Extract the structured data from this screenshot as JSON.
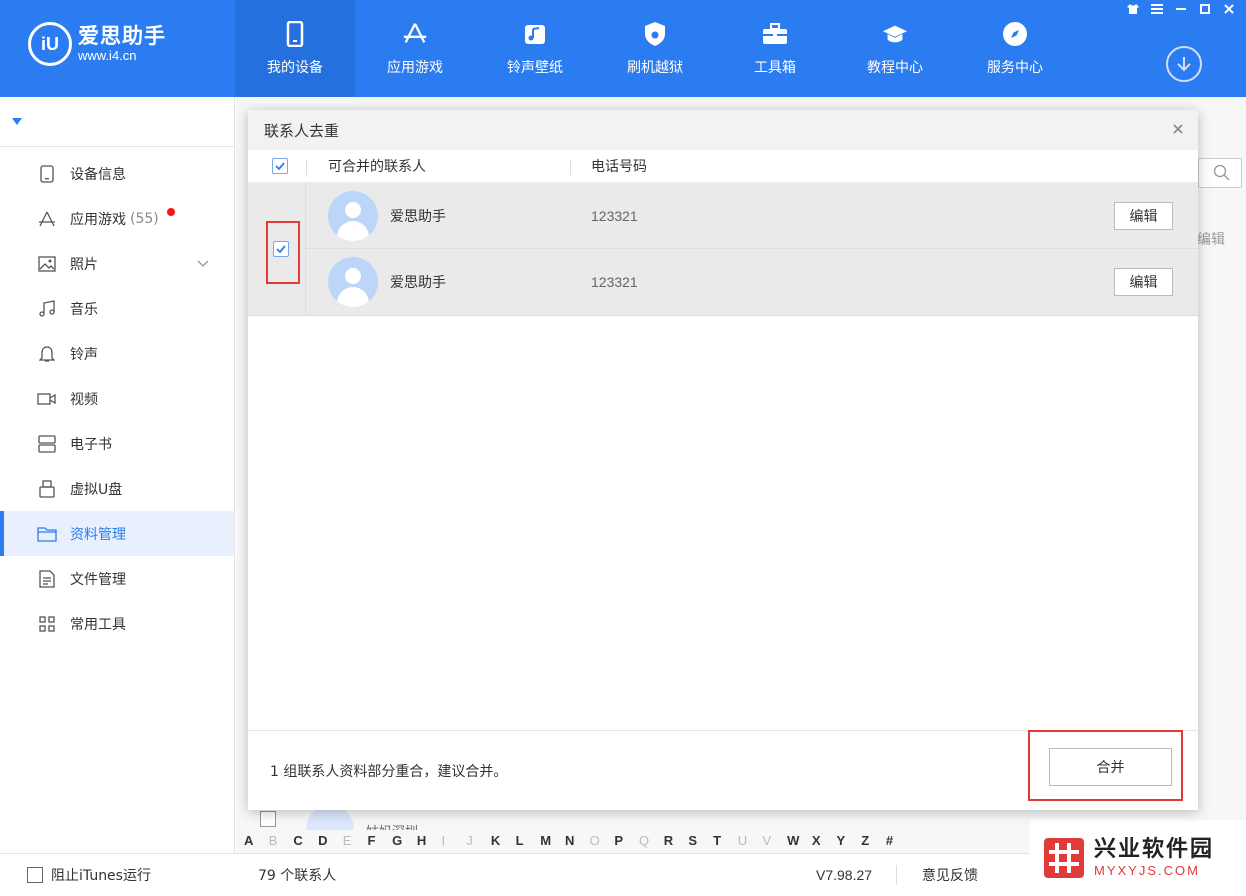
{
  "app": {
    "logo_mark": "iU",
    "logo_title": "爱思助手",
    "logo_url": "www.i4.cn"
  },
  "nav": [
    {
      "label": "我的设备",
      "icon": "phone-icon",
      "active": true
    },
    {
      "label": "应用游戏",
      "icon": "app-store-icon"
    },
    {
      "label": "铃声壁纸",
      "icon": "music-note-icon"
    },
    {
      "label": "刷机越狱",
      "icon": "shield-icon"
    },
    {
      "label": "工具箱",
      "icon": "toolbox-icon"
    },
    {
      "label": "教程中心",
      "icon": "graduation-cap-icon"
    },
    {
      "label": "服务中心",
      "icon": "compass-icon"
    }
  ],
  "sidebar": {
    "items": [
      {
        "label": "设备信息",
        "icon": "device-info-icon"
      },
      {
        "label": "应用游戏",
        "count": "(55)",
        "icon": "app-icon"
      },
      {
        "label": "照片",
        "icon": "photo-icon"
      },
      {
        "label": "音乐",
        "icon": "music-icon"
      },
      {
        "label": "铃声",
        "icon": "bell-icon"
      },
      {
        "label": "视频",
        "icon": "video-icon"
      },
      {
        "label": "电子书",
        "icon": "book-icon"
      },
      {
        "label": "虚拟U盘",
        "icon": "usb-icon"
      },
      {
        "label": "资料管理",
        "icon": "folder-icon",
        "active": true
      },
      {
        "label": "文件管理",
        "icon": "file-icon"
      },
      {
        "label": "常用工具",
        "icon": "grid-icon"
      }
    ]
  },
  "background": {
    "edit_label": "编辑",
    "partial_contact_name": "姑妈深圳"
  },
  "alphabet": [
    "A",
    "B",
    "C",
    "D",
    "E",
    "F",
    "G",
    "H",
    "I",
    "J",
    "K",
    "L",
    "M",
    "N",
    "O",
    "P",
    "Q",
    "R",
    "S",
    "T",
    "U",
    "V",
    "W",
    "X",
    "Y",
    "Z",
    "#"
  ],
  "alphabet_dim": [
    "B",
    "E",
    "I",
    "J",
    "O",
    "Q",
    "U",
    "V"
  ],
  "dialog": {
    "title": "联系人去重",
    "columns": {
      "name": "可合并的联系人",
      "phone": "电话号码"
    },
    "groups": [
      {
        "checked": true,
        "contacts": [
          {
            "name": "爱思助手",
            "phone": "123321",
            "edit_label": "编辑"
          },
          {
            "name": "爱思助手",
            "phone": "123321",
            "edit_label": "编辑"
          }
        ]
      }
    ],
    "footer_message": "1 组联系人资料部分重合，建议合并。",
    "merge_label": "合并"
  },
  "statusbar": {
    "block_itunes_label": "阻止iTunes运行",
    "contact_count": "79 个联系人",
    "version": "V7.98.27",
    "feedback": "意见反馈"
  },
  "watermark": {
    "title": "兴业软件园",
    "url": "MYXYJS.COM"
  },
  "colors": {
    "brand_blue": "#2b7cf0",
    "highlight_red": "#e03a3a"
  }
}
